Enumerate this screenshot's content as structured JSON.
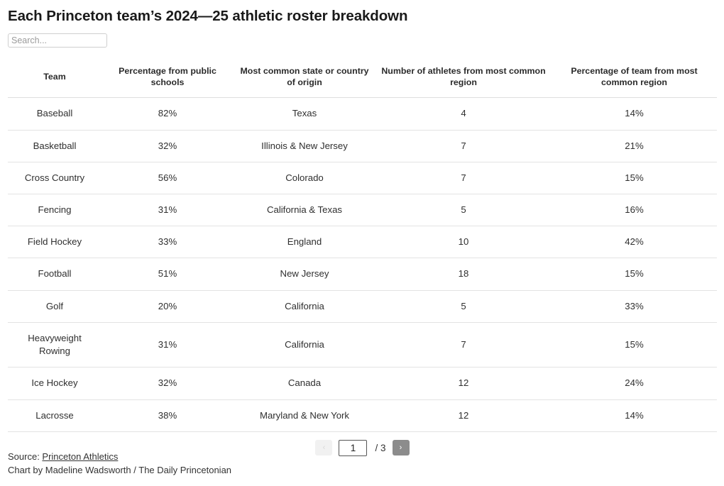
{
  "header": {
    "title": "Each Princeton team’s 2024—25 athletic roster breakdown"
  },
  "search": {
    "placeholder": "Search...",
    "value": ""
  },
  "table": {
    "columns": [
      "Team",
      "Percentage from public schools",
      "Most common state or country of origin",
      "Number of athletes from most common region",
      "Percentage of team from most common region"
    ],
    "rows": [
      {
        "team": "Baseball",
        "public_pct": "82%",
        "common_origin": "Texas",
        "athletes": "4",
        "team_pct": "14%"
      },
      {
        "team": "Basketball",
        "public_pct": "32%",
        "common_origin": "Illinois & New Jersey",
        "athletes": "7",
        "team_pct": "21%"
      },
      {
        "team": "Cross Country",
        "public_pct": "56%",
        "common_origin": "Colorado",
        "athletes": "7",
        "team_pct": "15%"
      },
      {
        "team": "Fencing",
        "public_pct": "31%",
        "common_origin": "California & Texas",
        "athletes": "5",
        "team_pct": "16%"
      },
      {
        "team": "Field Hockey",
        "public_pct": "33%",
        "common_origin": "England",
        "athletes": "10",
        "team_pct": "42%"
      },
      {
        "team": "Football",
        "public_pct": "51%",
        "common_origin": "New Jersey",
        "athletes": "18",
        "team_pct": "15%"
      },
      {
        "team": "Golf",
        "public_pct": "20%",
        "common_origin": "California",
        "athletes": "5",
        "team_pct": "33%"
      },
      {
        "team": "Heavyweight Rowing",
        "public_pct": "31%",
        "common_origin": "California",
        "athletes": "7",
        "team_pct": "15%"
      },
      {
        "team": "Ice Hockey",
        "public_pct": "32%",
        "common_origin": "Canada",
        "athletes": "12",
        "team_pct": "24%"
      },
      {
        "team": "Lacrosse",
        "public_pct": "38%",
        "common_origin": "Maryland & New York",
        "athletes": "12",
        "team_pct": "14%"
      }
    ]
  },
  "pagination": {
    "prev_label": "‹",
    "next_label": "›",
    "current_page": "1",
    "total_label": "/ 3"
  },
  "footer": {
    "source_prefix": "Source: ",
    "source_link": "Princeton Athletics",
    "credit": "Chart by Madeline Wadsworth / The Daily Princetonian"
  },
  "colors": {
    "text": "#2f2f2f",
    "title": "#1a1a1a",
    "rule": "#e3e3e3",
    "next_button": "#8c8c8c",
    "prev_button": "#f1f1f1"
  }
}
